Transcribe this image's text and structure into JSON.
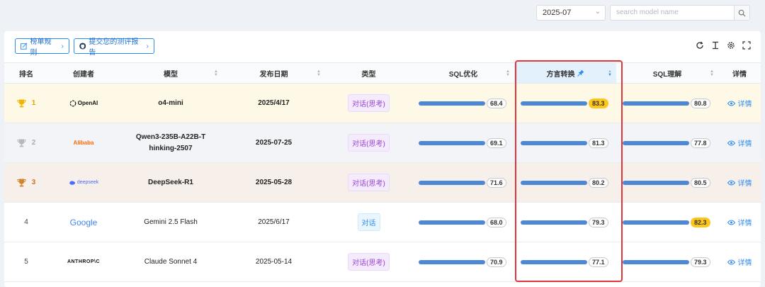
{
  "filters": {
    "month": "2025-07",
    "search_placeholder": "search model name"
  },
  "toolbar": {
    "rules_label": "榜单规则",
    "submit_label": "提交您的测评报告"
  },
  "table": {
    "headers": {
      "rank": "排名",
      "creator": "创建者",
      "model": "模型",
      "date": "发布日期",
      "type": "类型",
      "sql_opt": "SQL优化",
      "dialect": "方言转换",
      "sql_understand": "SQL理解",
      "detail": "详情"
    },
    "rows": [
      {
        "rank": "1",
        "creator": "OpenAI",
        "model": "o4-mini",
        "date": "2025/4/17",
        "type": "对话(思考)",
        "sql_opt": "68.4",
        "dialect": "83.3",
        "sql_understand": "80.8",
        "detail": "详情"
      },
      {
        "rank": "2",
        "creator": "Alibaba",
        "model": "Qwen3-235B-A22B-Thinking-2507",
        "date": "2025-07-25",
        "type": "对话(思考)",
        "sql_opt": "69.1",
        "dialect": "81.3",
        "sql_understand": "77.8",
        "detail": "详情"
      },
      {
        "rank": "3",
        "creator": "deepseek",
        "model": "DeepSeek-R1",
        "date": "2025-05-28",
        "type": "对话(思考)",
        "sql_opt": "71.6",
        "dialect": "80.2",
        "sql_understand": "80.5",
        "detail": "详情"
      },
      {
        "rank": "4",
        "creator": "Google",
        "model": "Gemini 2.5 Flash",
        "date": "2025/6/17",
        "type": "对话",
        "sql_opt": "68.0",
        "dialect": "79.3",
        "sql_understand": "82.3",
        "detail": "详情"
      },
      {
        "rank": "5",
        "creator": "ANTHROP\\C",
        "model": "Claude Sonnet 4",
        "date": "2025-05-14",
        "type": "对话(思考)",
        "sql_opt": "70.9",
        "dialect": "77.1",
        "sql_understand": "79.3",
        "detail": "详情"
      }
    ]
  },
  "colors": {
    "accent": "#2d8cf0",
    "bar": "#4d88d6",
    "top_score": "#ffc61a",
    "highlight_frame": "#e0363b"
  }
}
